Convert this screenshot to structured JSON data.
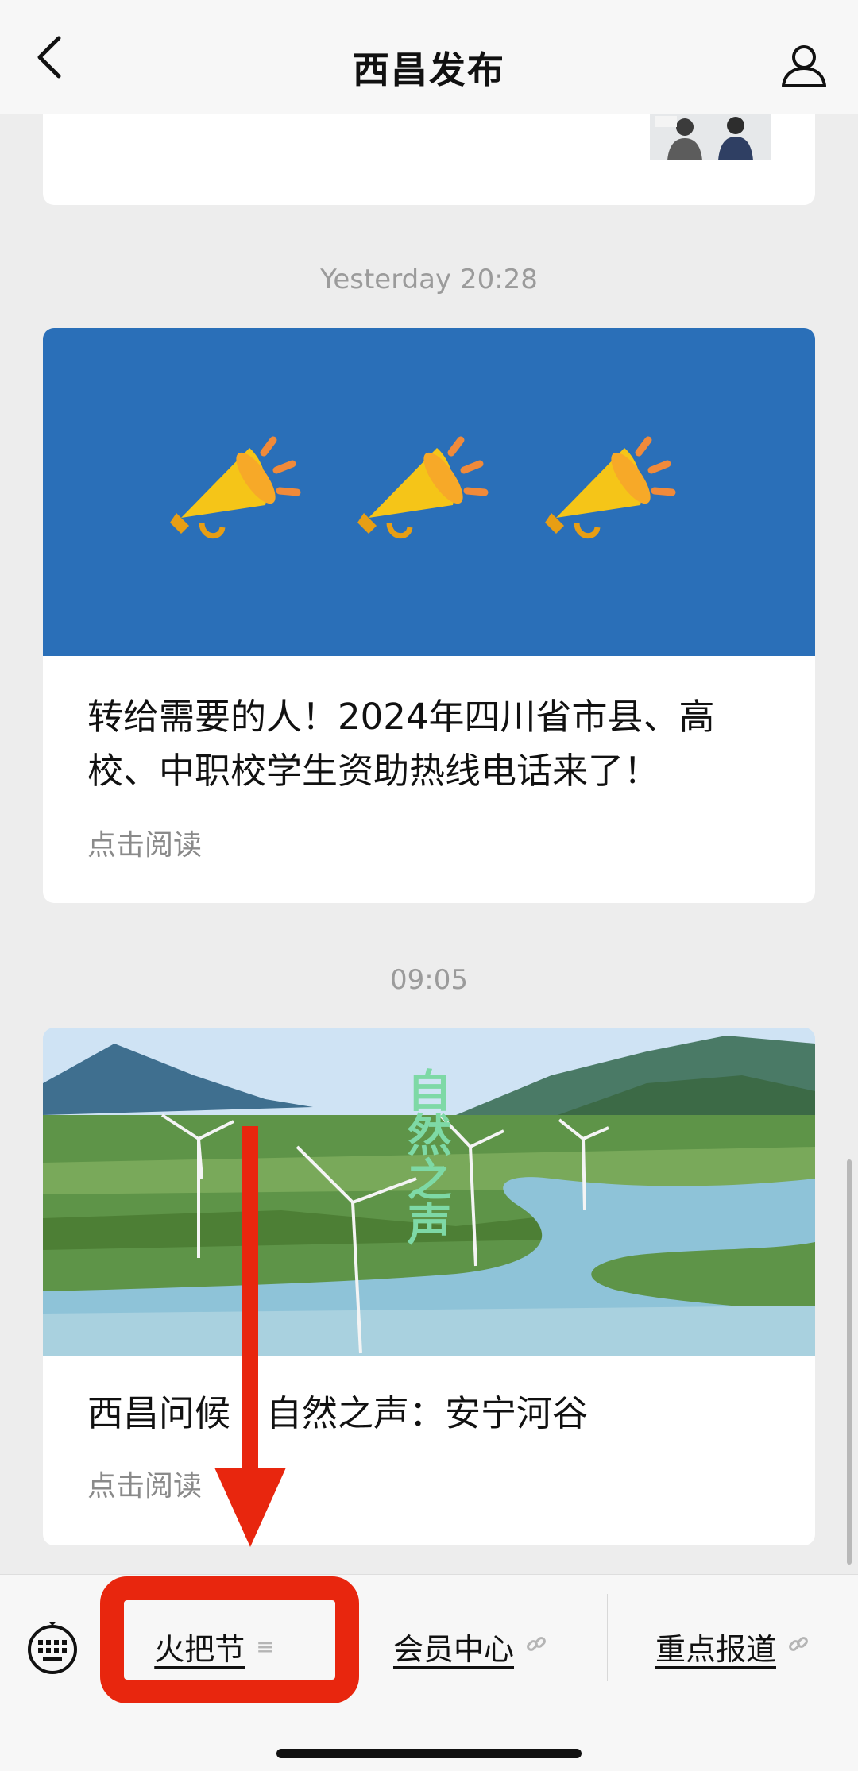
{
  "header": {
    "title": "西昌发布"
  },
  "feed": {
    "items": [
      {
        "timestamp": "Yesterday 20:28",
        "title": "转给需要的人！2024年四川省市县、高校、中职校学生资助热线电话来了！",
        "read_label": "点击阅读"
      },
      {
        "timestamp": "09:05",
        "title": "西昌问候丨自然之声：安宁河谷",
        "read_label": "点击阅读",
        "image_caption": "自然之声"
      }
    ]
  },
  "menu": {
    "items": [
      {
        "label": "火把节",
        "icon": "menu-lines-icon"
      },
      {
        "label": "会员中心",
        "icon": "link-icon"
      },
      {
        "label": "重点报道",
        "icon": "link-icon"
      }
    ]
  },
  "colors": {
    "accent_annotation": "#e8260e",
    "banner_blue": "#2a6fb8",
    "background": "#ededed"
  }
}
